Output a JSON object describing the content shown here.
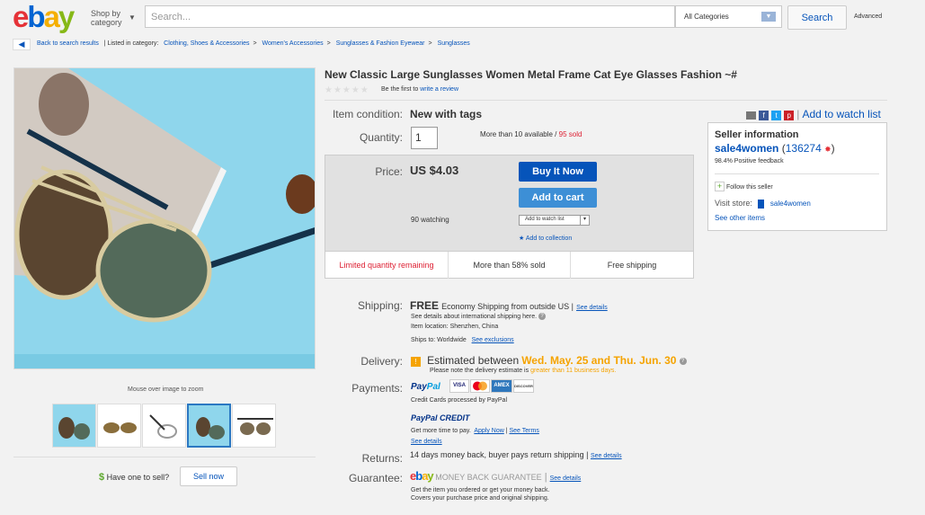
{
  "header": {
    "logo": [
      "e",
      "b",
      "a",
      "y"
    ],
    "shop_by": "Shop by",
    "category": "category",
    "search_placeholder": "Search...",
    "category_select": "All Categories",
    "search_button": "Search",
    "advanced": "Advanced"
  },
  "breadcrumb": {
    "back": "Back to search results",
    "listed_in": "| Listed in category:",
    "items": [
      "Clothing, Shoes & Accessories",
      "Women's Accessories",
      "Sunglasses & Fashion Eyewear",
      "Sunglasses"
    ],
    "sep": ">"
  },
  "gallery": {
    "zoom_hint": "Mouse over image to zoom",
    "thumbnail_count": 5,
    "selected_index": 3
  },
  "sell": {
    "dollar": "$",
    "question": "Have one to sell?",
    "button": "Sell now"
  },
  "item": {
    "title": "New Classic Large Sunglasses Women Metal Frame Cat Eye Glasses Fashion ~#",
    "stars": "★★★★★",
    "review_prefix": "Be the first to",
    "review_link": "write a review",
    "condition_label": "Item condition:",
    "condition_value": "New with tags",
    "quantity_label": "Quantity:",
    "quantity_value": "1",
    "availability": "More than 10 available /",
    "sold": "95 sold",
    "price_label": "Price:",
    "price": "US $4.03",
    "buy_now": "Buy It Now",
    "add_to_cart": "Add to cart",
    "watching": "90 watching",
    "watch_list_select": "Add to watch list",
    "add_collection": "Add to collection",
    "limited": "Limited quantity remaining",
    "more_sold": "More than 58% sold",
    "free_shipping": "Free shipping",
    "watch_list_link": "Add to watch list"
  },
  "shipping": {
    "label": "Shipping:",
    "free": "FREE",
    "method": "Economy Shipping from outside US |",
    "see_details": "See details",
    "intl_note": "See details about international shipping here.",
    "item_location": "Item location: Shenzhen, China",
    "ships_to": "Ships to: Worldwide",
    "see_exclusions": "See exclusions"
  },
  "delivery": {
    "label": "Delivery:",
    "estimated": "Estimated between",
    "dates": "Wed. May. 25 and Thu. Jun. 30",
    "note_prefix": "Please note the delivery estimate is",
    "note_emph": "greater than 11 business days."
  },
  "payments": {
    "label": "Payments:",
    "paypal_a": "Pay",
    "paypal_b": "Pal",
    "cards": [
      "VISA",
      "MC",
      "AMEX",
      "DISCOVER"
    ],
    "credit_cards": "Credit Cards processed by PayPal",
    "paypal_credit": "PayPal CREDIT",
    "more_time": "Get more time to pay.",
    "apply_now": "Apply Now",
    "see_terms": "See Terms",
    "see_details": "See details"
  },
  "returns": {
    "label": "Returns:",
    "text": "14 days money back, buyer pays return shipping |",
    "see_details": "See details"
  },
  "guarantee": {
    "label": "Guarantee:",
    "ebay_mbg": "MONEY BACK GUARANTEE",
    "see_details": "See details",
    "line1": "Get the item you ordered or get your money back.",
    "line2": "Covers your purchase price and original shipping."
  },
  "seller": {
    "heading": "Seller information",
    "name": "sale4women",
    "score": "136274",
    "feedback": "98.4% Positive feedback",
    "follow": "Follow this seller",
    "visit_store": "Visit store:",
    "store_name": "sale4women",
    "other_items": "See other items"
  },
  "colors": {
    "link": "#0654ba",
    "buy_now": "#0654ba",
    "add_cart": "#3d8fd6",
    "delivery_dates": "#f5a300",
    "sold": "#dd1e31"
  }
}
